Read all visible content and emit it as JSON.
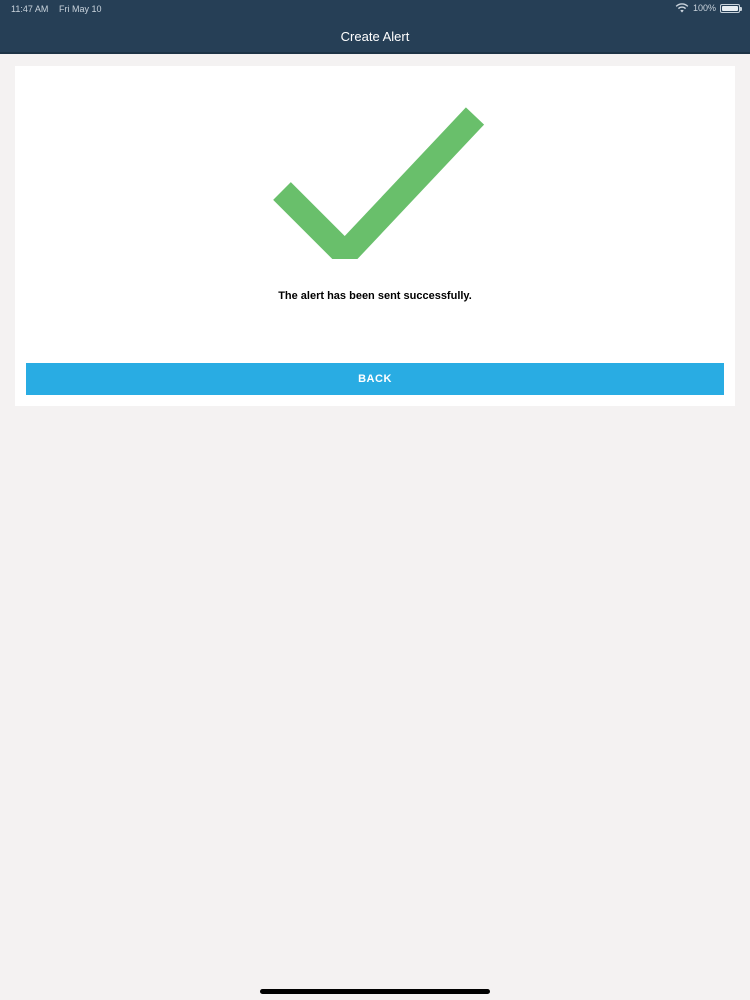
{
  "status_bar": {
    "time": "11:47 AM",
    "date": "Fri May 10",
    "battery": "100%",
    "battery_level": 1.0
  },
  "header": {
    "title": "Create Alert"
  },
  "result": {
    "icon": "checkmark-icon",
    "icon_color": "#69bf6b",
    "message": "The alert has been sent successfully."
  },
  "actions": {
    "back_label": "BACK",
    "back_color": "#29ace3"
  },
  "colors": {
    "header_bg": "#263f56",
    "page_bg": "#f4f2f2",
    "card_bg": "#ffffff"
  }
}
